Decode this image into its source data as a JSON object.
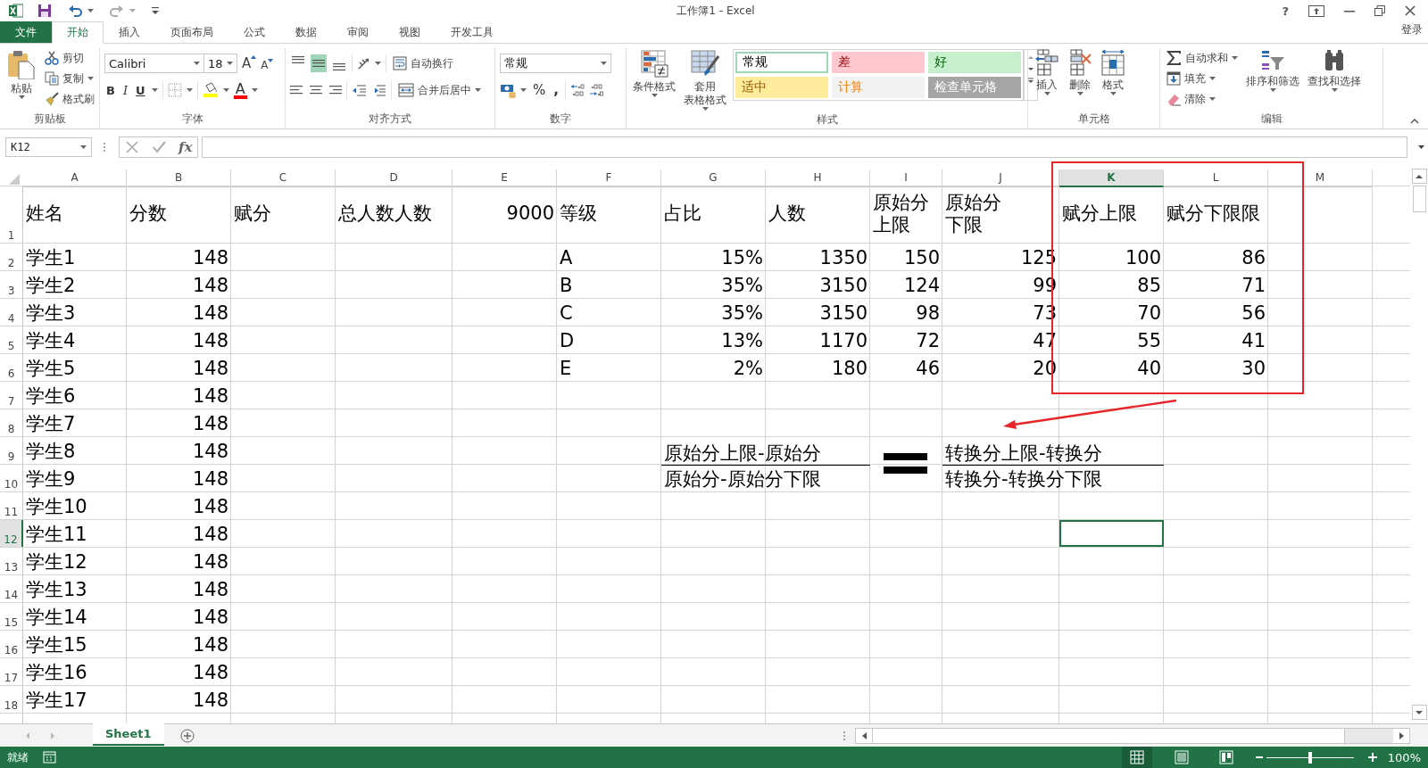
{
  "window": {
    "title": "工作簿1 - Excel",
    "help": "?",
    "sign_in": "登录"
  },
  "tabs": [
    {
      "label": "文件",
      "kind": "file",
      "selected": false
    },
    {
      "label": "开始",
      "kind": "tab",
      "selected": true
    },
    {
      "label": "插入",
      "kind": "tab",
      "selected": false
    },
    {
      "label": "页面布局",
      "kind": "tab",
      "selected": false
    },
    {
      "label": "公式",
      "kind": "tab",
      "selected": false
    },
    {
      "label": "数据",
      "kind": "tab",
      "selected": false
    },
    {
      "label": "审阅",
      "kind": "tab",
      "selected": false
    },
    {
      "label": "视图",
      "kind": "tab",
      "selected": false
    },
    {
      "label": "开发工具",
      "kind": "tab",
      "selected": false
    }
  ],
  "ribbon": {
    "clipboard": {
      "label": "剪贴板",
      "paste": "粘贴",
      "cut": "剪切",
      "copy": "复制",
      "format_painter": "格式刷"
    },
    "font": {
      "label": "字体",
      "name": "Calibri",
      "size": "18",
      "grow": "A",
      "shrink": "A",
      "bold": "B",
      "italic": "I",
      "underline": "U",
      "font_color": "A"
    },
    "alignment": {
      "label": "对齐方式",
      "vertical": [
        {
          "selected": false
        },
        {
          "selected": true
        },
        {
          "selected": false
        }
      ],
      "wrap_text": "自动换行",
      "merge": "合并后居中"
    },
    "number": {
      "label": "数字",
      "format": "常规",
      "percent": "%",
      "comma": ","
    },
    "styles": {
      "label": "样式",
      "conditional": "条件格式",
      "format_table": [
        "套用",
        "表格格式"
      ],
      "gallery": [
        {
          "text": "常规",
          "color": "#ffffff",
          "selected": true
        },
        {
          "text": "差",
          "color": "#ffc7ce",
          "selected": false
        },
        {
          "text": "好",
          "color": "#c6efce",
          "selected": false
        },
        {
          "text": "适中",
          "color": "#ffeb9c",
          "selected": false
        },
        {
          "text": "计算",
          "color": "#f2f2f2",
          "selected": false
        },
        {
          "text": "检查单元格",
          "color": "#a5a5a5",
          "selected": false
        }
      ]
    },
    "cells": {
      "label": "单元格",
      "buttons": [
        {
          "label": "插入",
          "kind": "insert"
        },
        {
          "label": "删除",
          "kind": "delete"
        },
        {
          "label": "格式",
          "kind": "format"
        }
      ]
    },
    "editing": {
      "label": "编辑",
      "autosum": "自动求和",
      "fill": "填充",
      "clear": "清除",
      "sort": "排序和筛选",
      "find": "查找和选择"
    }
  },
  "formula_bar": {
    "name_box": "K12",
    "function_label": "fx"
  },
  "columns": [
    {
      "label": "A",
      "selected": false
    },
    {
      "label": "B",
      "selected": false
    },
    {
      "label": "C",
      "selected": false
    },
    {
      "label": "D",
      "selected": false
    },
    {
      "label": "E",
      "selected": false
    },
    {
      "label": "F",
      "selected": false
    },
    {
      "label": "G",
      "selected": false
    },
    {
      "label": "H",
      "selected": false
    },
    {
      "label": "I",
      "selected": false
    },
    {
      "label": "J",
      "selected": false
    },
    {
      "label": "K",
      "selected": true
    },
    {
      "label": "L",
      "selected": false
    },
    {
      "label": "M",
      "selected": false
    }
  ],
  "rows": [
    {
      "label": "1",
      "selected": false,
      "cells": [
        {
          "text": "姓名",
          "kind": "text"
        },
        {
          "text": "分数",
          "kind": "text"
        },
        {
          "text": "赋分",
          "kind": "text"
        },
        {
          "text": "总人数人数",
          "kind": "text"
        },
        {
          "text": "9000",
          "kind": "number"
        },
        {
          "text": "等级",
          "kind": "text"
        },
        {
          "text": "占比",
          "kind": "text"
        },
        {
          "text": "人数",
          "kind": "text"
        },
        {
          "text": "原始分上限",
          "kind": "wrapped"
        },
        {
          "text": "原始分下限",
          "kind": "wrapped"
        },
        {
          "text": "赋分上限",
          "kind": "text"
        },
        {
          "text": "赋分下限限",
          "kind": "text"
        }
      ]
    },
    {
      "label": "2",
      "selected": false,
      "cells": [
        {
          "text": "学生1",
          "kind": "text"
        },
        {
          "text": "148",
          "kind": "number"
        },
        null,
        null,
        null,
        {
          "text": "A",
          "kind": "text"
        },
        {
          "text": "15%",
          "kind": "number"
        },
        {
          "text": "1350",
          "kind": "number"
        },
        {
          "text": "150",
          "kind": "number"
        },
        {
          "text": "125",
          "kind": "number"
        },
        {
          "text": "100",
          "kind": "number"
        },
        {
          "text": "86",
          "kind": "number"
        }
      ]
    },
    {
      "label": "3",
      "selected": false,
      "cells": [
        {
          "text": "学生2",
          "kind": "text"
        },
        {
          "text": "148",
          "kind": "number"
        },
        null,
        null,
        null,
        {
          "text": "B",
          "kind": "text"
        },
        {
          "text": "35%",
          "kind": "number"
        },
        {
          "text": "3150",
          "kind": "number"
        },
        {
          "text": "124",
          "kind": "number"
        },
        {
          "text": "99",
          "kind": "number"
        },
        {
          "text": "85",
          "kind": "number"
        },
        {
          "text": "71",
          "kind": "number"
        }
      ]
    },
    {
      "label": "4",
      "selected": false,
      "cells": [
        {
          "text": "学生3",
          "kind": "text"
        },
        {
          "text": "148",
          "kind": "number"
        },
        null,
        null,
        null,
        {
          "text": "C",
          "kind": "text"
        },
        {
          "text": "35%",
          "kind": "number"
        },
        {
          "text": "3150",
          "kind": "number"
        },
        {
          "text": "98",
          "kind": "number"
        },
        {
          "text": "73",
          "kind": "number"
        },
        {
          "text": "70",
          "kind": "number"
        },
        {
          "text": "56",
          "kind": "number"
        }
      ]
    },
    {
      "label": "5",
      "selected": false,
      "cells": [
        {
          "text": "学生4",
          "kind": "text"
        },
        {
          "text": "148",
          "kind": "number"
        },
        null,
        null,
        null,
        {
          "text": "D",
          "kind": "text"
        },
        {
          "text": "13%",
          "kind": "number"
        },
        {
          "text": "1170",
          "kind": "number"
        },
        {
          "text": "72",
          "kind": "number"
        },
        {
          "text": "47",
          "kind": "number"
        },
        {
          "text": "55",
          "kind": "number"
        },
        {
          "text": "41",
          "kind": "number"
        }
      ]
    },
    {
      "label": "6",
      "selected": false,
      "cells": [
        {
          "text": "学生5",
          "kind": "text"
        },
        {
          "text": "148",
          "kind": "number"
        },
        null,
        null,
        null,
        {
          "text": "E",
          "kind": "text"
        },
        {
          "text": "2%",
          "kind": "number"
        },
        {
          "text": "180",
          "kind": "number"
        },
        {
          "text": "46",
          "kind": "number"
        },
        {
          "text": "20",
          "kind": "number"
        },
        {
          "text": "40",
          "kind": "number"
        },
        {
          "text": "30",
          "kind": "number"
        }
      ]
    },
    {
      "label": "7",
      "selected": false,
      "cells": [
        {
          "text": "学生6",
          "kind": "text"
        },
        {
          "text": "148",
          "kind": "number"
        }
      ]
    },
    {
      "label": "8",
      "selected": false,
      "cells": [
        {
          "text": "学生7",
          "kind": "text"
        },
        {
          "text": "148",
          "kind": "number"
        }
      ]
    },
    {
      "label": "9",
      "selected": false,
      "cells": [
        {
          "text": "学生8",
          "kind": "text"
        },
        {
          "text": "148",
          "kind": "number"
        },
        null,
        null,
        null,
        null,
        {
          "text": "原始分上限-原始分",
          "kind": "numerator"
        },
        null,
        null,
        {
          "text": "转换分上限-转换分",
          "kind": "numerator"
        }
      ]
    },
    {
      "label": "10",
      "selected": false,
      "cells": [
        {
          "text": "学生9",
          "kind": "text"
        },
        {
          "text": "148",
          "kind": "number"
        },
        null,
        null,
        null,
        null,
        {
          "text": "原始分-原始分下限",
          "kind": "text"
        },
        null,
        null,
        {
          "text": "转换分-转换分下限",
          "kind": "text"
        }
      ]
    },
    {
      "label": "11",
      "selected": false,
      "cells": [
        {
          "text": "学生10",
          "kind": "text"
        },
        {
          "text": "148",
          "kind": "number"
        }
      ]
    },
    {
      "label": "12",
      "selected": true,
      "cells": [
        {
          "text": "学生11",
          "kind": "text"
        },
        {
          "text": "148",
          "kind": "number"
        }
      ]
    },
    {
      "label": "13",
      "selected": false,
      "cells": [
        {
          "text": "学生12",
          "kind": "text"
        },
        {
          "text": "148",
          "kind": "number"
        }
      ]
    },
    {
      "label": "14",
      "selected": false,
      "cells": [
        {
          "text": "学生13",
          "kind": "text"
        },
        {
          "text": "148",
          "kind": "number"
        }
      ]
    },
    {
      "label": "15",
      "selected": false,
      "cells": [
        {
          "text": "学生14",
          "kind": "text"
        },
        {
          "text": "148",
          "kind": "number"
        }
      ]
    },
    {
      "label": "16",
      "selected": false,
      "cells": [
        {
          "text": "学生15",
          "kind": "text"
        },
        {
          "text": "148",
          "kind": "number"
        }
      ]
    },
    {
      "label": "17",
      "selected": false,
      "cells": [
        {
          "text": "学生16",
          "kind": "text"
        },
        {
          "text": "148",
          "kind": "number"
        }
      ]
    },
    {
      "label": "18",
      "selected": false,
      "cells": [
        {
          "text": "学生17",
          "kind": "text"
        },
        {
          "text": "148",
          "kind": "number"
        }
      ]
    }
  ],
  "sheets": [
    {
      "label": "Sheet1",
      "selected": true
    }
  ],
  "status_bar": {
    "status": "就绪",
    "views": [
      {
        "selected": true
      },
      {
        "selected": false
      },
      {
        "selected": false
      }
    ],
    "zoom": {
      "level": 0.5,
      "reading": "100%"
    }
  }
}
